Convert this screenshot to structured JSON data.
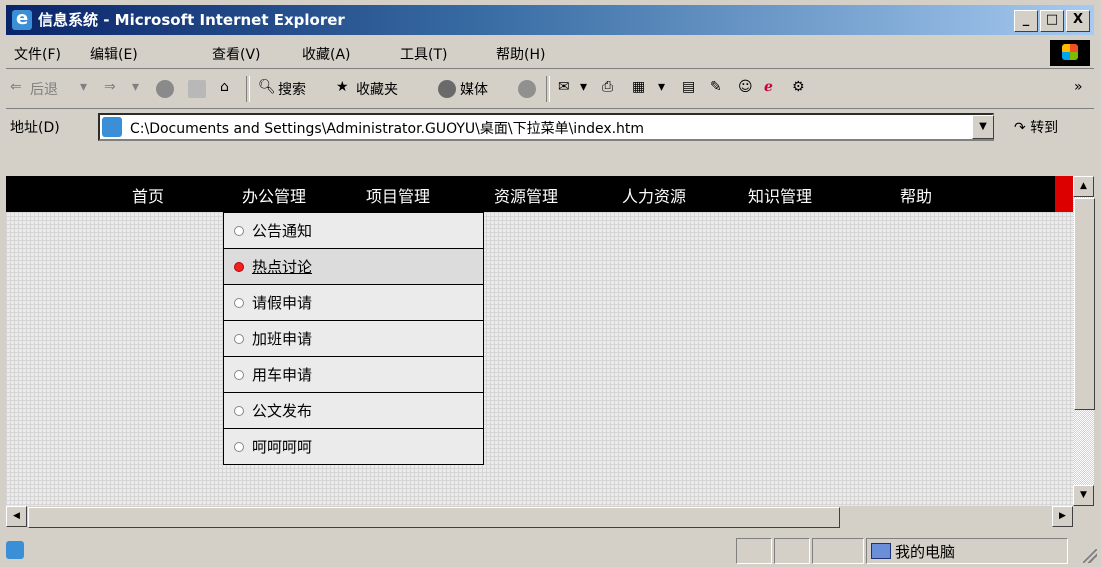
{
  "window": {
    "title": "信息系统 - Microsoft Internet Explorer",
    "controls": [
      "_",
      "□",
      "X"
    ]
  },
  "menubar": {
    "items": [
      "文件(F)",
      "编辑(E)",
      "查看(V)",
      "收藏(A)",
      "工具(T)",
      "帮助(H)"
    ]
  },
  "toolbar": {
    "back": "后退",
    "search": "搜索",
    "favorites": "收藏夹",
    "media": "媒体"
  },
  "address": {
    "label": "地址(D)",
    "value": "C:\\Documents and Settings\\Administrator.GUOYU\\桌面\\下拉菜单\\index.htm",
    "go": "转到"
  },
  "nav": {
    "items": [
      "首页",
      "办公管理",
      "项目管理",
      "资源管理",
      "人力资源",
      "知识管理",
      "帮助"
    ]
  },
  "dropdown": {
    "items": [
      "公告通知",
      "热点讨论",
      "请假申请",
      "加班申请",
      "用车申请",
      "公文发布",
      "呵呵呵呵"
    ],
    "active": "热点讨论"
  },
  "status": {
    "zone": "我的电脑"
  }
}
